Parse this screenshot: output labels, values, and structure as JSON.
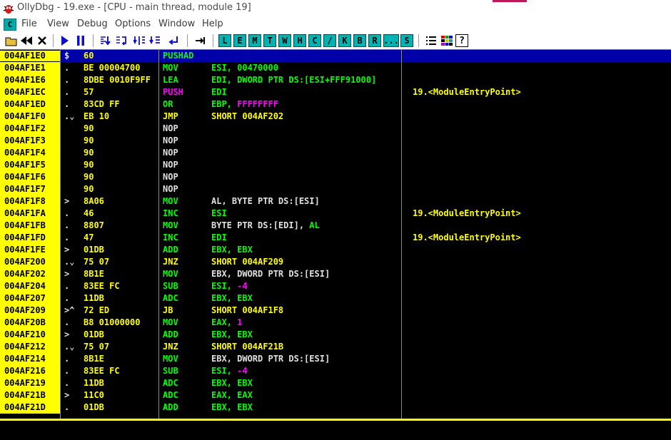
{
  "window": {
    "title": "OllyDbg - 19.exe - [CPU - main thread, module 19]"
  },
  "menu": {
    "items": [
      "File",
      "View",
      "Debug",
      "Options",
      "Window",
      "Help"
    ]
  },
  "toolbar": {
    "letter_buttons": [
      "L",
      "E",
      "M",
      "T",
      "W",
      "H",
      "C",
      "/",
      "K",
      "B",
      "R",
      "...",
      "S"
    ]
  },
  "disassembly": {
    "rows": [
      {
        "addr": "004AF1E0",
        "mark": "$",
        "hex": "60",
        "mn": "PUSHAD",
        "ops": [],
        "comment": ""
      },
      {
        "addr": "004AF1E1",
        "mark": ".",
        "hex": "BE 00004700",
        "mn": "MOV",
        "ops": [
          "ESI, 00470000"
        ],
        "comment": ""
      },
      {
        "addr": "004AF1E6",
        "mark": ".",
        "hex": "8DBE 0010F9FF",
        "mn": "LEA",
        "ops": [
          "EDI, DWORD PTR DS:[ESI+FFF91000]"
        ],
        "comment": ""
      },
      {
        "addr": "004AF1EC",
        "mark": ".",
        "hex": "57",
        "mn": "PUSH",
        "ops": [
          "EDI"
        ],
        "comment": "19.<ModuleEntryPoint>"
      },
      {
        "addr": "004AF1ED",
        "mark": ".",
        "hex": "83CD FF",
        "mn": "OR",
        "ops": [
          "EBP, ",
          "FFFFFFFF"
        ],
        "comment": ""
      },
      {
        "addr": "004AF1F0",
        "mark": ".⌄",
        "hex": "EB 10",
        "mn": "JMP",
        "ops": [
          "SHORT 004AF202"
        ],
        "comment": ""
      },
      {
        "addr": "004AF1F2",
        "mark": "",
        "hex": "90",
        "mn": "NOP",
        "ops": [],
        "comment": ""
      },
      {
        "addr": "004AF1F3",
        "mark": "",
        "hex": "90",
        "mn": "NOP",
        "ops": [],
        "comment": ""
      },
      {
        "addr": "004AF1F4",
        "mark": "",
        "hex": "90",
        "mn": "NOP",
        "ops": [],
        "comment": ""
      },
      {
        "addr": "004AF1F5",
        "mark": "",
        "hex": "90",
        "mn": "NOP",
        "ops": [],
        "comment": ""
      },
      {
        "addr": "004AF1F6",
        "mark": "",
        "hex": "90",
        "mn": "NOP",
        "ops": [],
        "comment": ""
      },
      {
        "addr": "004AF1F7",
        "mark": "",
        "hex": "90",
        "mn": "NOP",
        "ops": [],
        "comment": ""
      },
      {
        "addr": "004AF1F8",
        "mark": ">",
        "hex": "8A06",
        "mn": "MOV",
        "ops": [
          "AL, BYTE PTR DS:[ESI]"
        ],
        "comment": ""
      },
      {
        "addr": "004AF1FA",
        "mark": ".",
        "hex": "46",
        "mn": "INC",
        "ops": [
          "ESI"
        ],
        "comment": "19.<ModuleEntryPoint>"
      },
      {
        "addr": "004AF1FB",
        "mark": ".",
        "hex": "8807",
        "mn": "MOV",
        "ops": [
          "BYTE PTR DS:[EDI], ",
          "AL"
        ],
        "comment": ""
      },
      {
        "addr": "004AF1FD",
        "mark": ".",
        "hex": "47",
        "mn": "INC",
        "ops": [
          "EDI"
        ],
        "comment": "19.<ModuleEntryPoint>"
      },
      {
        "addr": "004AF1FE",
        "mark": ">",
        "hex": "01DB",
        "mn": "ADD",
        "ops": [
          "EBX, EBX"
        ],
        "comment": ""
      },
      {
        "addr": "004AF200",
        "mark": ".⌄",
        "hex": "75 07",
        "mn": "JNZ",
        "ops": [
          "SHORT 004AF209"
        ],
        "comment": ""
      },
      {
        "addr": "004AF202",
        "mark": ">",
        "hex": "8B1E",
        "mn": "MOV",
        "ops": [
          "EBX, DWORD PTR DS:[ESI]"
        ],
        "comment": ""
      },
      {
        "addr": "004AF204",
        "mark": ".",
        "hex": "83EE FC",
        "mn": "SUB",
        "ops": [
          "ESI, ",
          "-4"
        ],
        "comment": ""
      },
      {
        "addr": "004AF207",
        "mark": ".",
        "hex": "11DB",
        "mn": "ADC",
        "ops": [
          "EBX, EBX"
        ],
        "comment": ""
      },
      {
        "addr": "004AF209",
        "mark": ">^",
        "hex": "72 ED",
        "mn": "JB",
        "ops": [
          "SHORT 004AF1F8"
        ],
        "comment": ""
      },
      {
        "addr": "004AF20B",
        "mark": ".",
        "hex": "B8 01000000",
        "mn": "MOV",
        "ops": [
          "EAX, ",
          "1"
        ],
        "comment": ""
      },
      {
        "addr": "004AF210",
        "mark": ">",
        "hex": "01DB",
        "mn": "ADD",
        "ops": [
          "EBX, EBX"
        ],
        "comment": ""
      },
      {
        "addr": "004AF212",
        "mark": ".⌄",
        "hex": "75 07",
        "mn": "JNZ",
        "ops": [
          "SHORT 004AF21B"
        ],
        "comment": ""
      },
      {
        "addr": "004AF214",
        "mark": ".",
        "hex": "8B1E",
        "mn": "MOV",
        "ops": [
          "EBX, DWORD PTR DS:[ESI]"
        ],
        "comment": ""
      },
      {
        "addr": "004AF216",
        "mark": ".",
        "hex": "83EE FC",
        "mn": "SUB",
        "ops": [
          "ESI, ",
          "-4"
        ],
        "comment": ""
      },
      {
        "addr": "004AF219",
        "mark": ".",
        "hex": "11DB",
        "mn": "ADC",
        "ops": [
          "EBX, EBX"
        ],
        "comment": ""
      },
      {
        "addr": "004AF21B",
        "mark": ">",
        "hex": "11C0",
        "mn": "ADC",
        "ops": [
          "EAX, EAX"
        ],
        "comment": ""
      },
      {
        "addr": "004AF21D",
        "mark": ".",
        "hex": "01DB",
        "mn": "ADD",
        "ops": [
          "EBX, EBX"
        ],
        "comment": ""
      }
    ]
  },
  "colors": {
    "address_bg": "#ffff00",
    "selection_bg": "#0000a8",
    "pane_bg": "#000000",
    "hex_bytes": "#ffff00",
    "mnemonic": "#00ff00",
    "push_mnemonic": "#ff00ff",
    "jump": "#ffff00",
    "comment": "#ffff00"
  }
}
